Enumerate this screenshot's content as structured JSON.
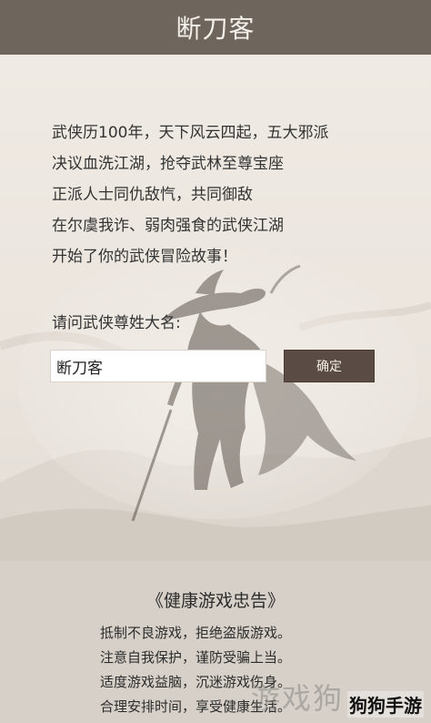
{
  "header": {
    "title": "断刀客"
  },
  "story": {
    "lines": [
      "武侠历100年，天下风云四起，五大邪派",
      "决议血洗江湖，抢夺武林至尊宝座",
      "正派人士同仇敌忾，共同御敌",
      "在尔虞我诈、弱肉强食的武侠江湖",
      "开始了你的武侠冒险故事！"
    ]
  },
  "form": {
    "label": "请问武侠尊姓大名:",
    "name_value": "断刀客",
    "confirm_label": "确定"
  },
  "notice": {
    "title": "《健康游戏忠告》",
    "lines": [
      "抵制不良游戏，拒绝盗版游戏。",
      "注意自我保护，谨防受骗上当。",
      "适度游戏益脑，沉迷游戏伤身。",
      "合理安排时间，享受健康生活。"
    ]
  },
  "watermark": {
    "faint": "游戏狗",
    "brand": "狗狗手游"
  },
  "colors": {
    "header_bg": "#6e655d",
    "button_bg": "#5a4c44",
    "notice_bg": "#d6d0c8"
  }
}
